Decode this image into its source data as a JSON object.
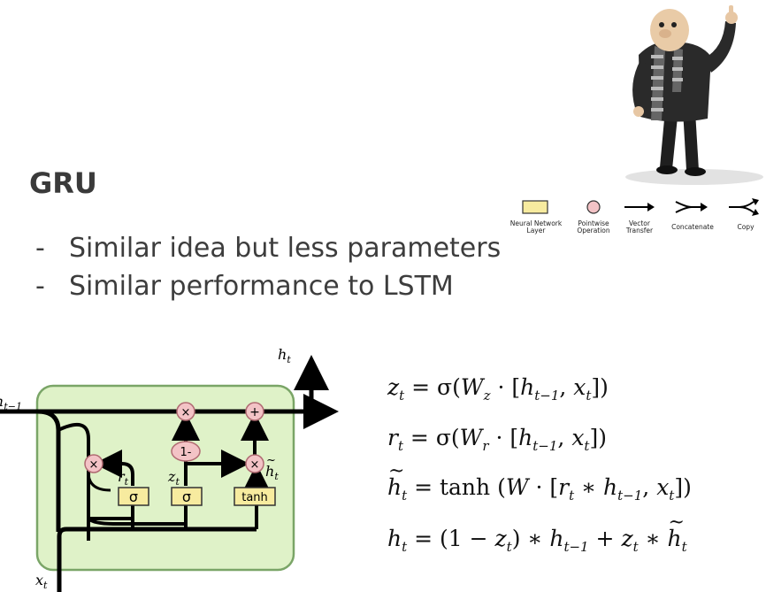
{
  "slide": {
    "title": "GRU",
    "bullets": [
      "Similar idea but less parameters",
      "Similar performance to LSTM"
    ]
  },
  "legend": {
    "items": [
      {
        "label_line1": "Neural Network",
        "label_line2": "Layer",
        "icon": "yellow-rectangle-icon"
      },
      {
        "label_line1": "Pointwise",
        "label_line2": "Operation",
        "icon": "pink-circle-icon"
      },
      {
        "label_line1": "Vector",
        "label_line2": "Transfer",
        "icon": "arrow-icon"
      },
      {
        "label_line1": "Concatenate",
        "label_line2": "",
        "icon": "concatenate-icon"
      },
      {
        "label_line1": "Copy",
        "label_line2": "",
        "icon": "copy-icon"
      }
    ]
  },
  "diagram": {
    "labels": {
      "h_t_out": "h",
      "h_t_out_sub": "t",
      "h_prev": "h",
      "h_prev_sub": "t−1",
      "x_t": "x",
      "x_t_sub": "t",
      "r_t": "r",
      "r_t_sub": "t",
      "z_t": "z",
      "z_t_sub": "t",
      "h_tilde": "h",
      "h_tilde_sub": "t"
    },
    "ops": {
      "mul": "×",
      "add": "+",
      "one_minus": "1-"
    },
    "layers": {
      "sigma_r": "σ",
      "sigma_z": "σ",
      "tanh": "tanh"
    },
    "colors": {
      "cell_fill": "#dff2c8",
      "cell_stroke": "#7aa567",
      "layer_fill": "#f7eb9f",
      "op_fill": "#f3c3c6",
      "op_stroke": "#b06a72"
    }
  },
  "equations": [
    "z_t = σ(W_z · [h_{t−1}, x_t])",
    "r_t = σ(W_r · [h_{t−1}, x_t])",
    "h̃_t = tanh(W · [r_t ∗ h_{t−1}, x_t])",
    "h_t = (1 − z_t) ∗ h_{t−1} + z_t ∗ h̃_t"
  ],
  "eq_parts": {
    "z": "z",
    "r": "r",
    "h": "h",
    "t": "t",
    "tm1": "t−1",
    "W": "W",
    "Wz": "z",
    "Wr": "r",
    "x": "x",
    "eq": " = ",
    "sigma": "σ",
    "tanh": "tanh",
    "dot": " · ",
    "star": " ∗ ",
    "one_minus": "(1 − ",
    "plus": " + "
  }
}
